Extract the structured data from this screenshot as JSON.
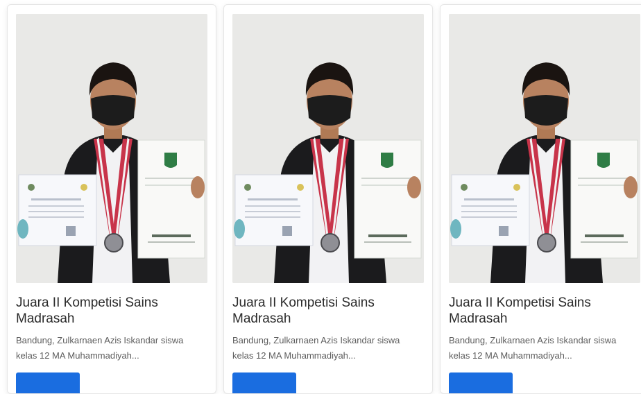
{
  "cards": [
    {
      "title": "Juara II Kompetisi Sains Madrasah",
      "description": "Bandung, Zulkarnaen Azis Iskandar siswa kelas 12 MA Muhammadiyah...",
      "image": "student-with-certificates-photo"
    },
    {
      "title": "Juara II Kompetisi Sains Madrasah",
      "description": "Bandung, Zulkarnaen Azis Iskandar siswa kelas 12 MA Muhammadiyah...",
      "image": "student-with-certificates-photo"
    },
    {
      "title": "Juara II Kompetisi Sains Madrasah",
      "description": "Bandung, Zulkarnaen Azis Iskandar siswa kelas 12 MA Muhammadiyah...",
      "image": "student-with-certificates-photo"
    }
  ],
  "colors": {
    "button": "#1a6de0",
    "title_text": "#2b2b2b",
    "description_text": "#5c5c5c",
    "photo_background": "#e9e9e7"
  }
}
